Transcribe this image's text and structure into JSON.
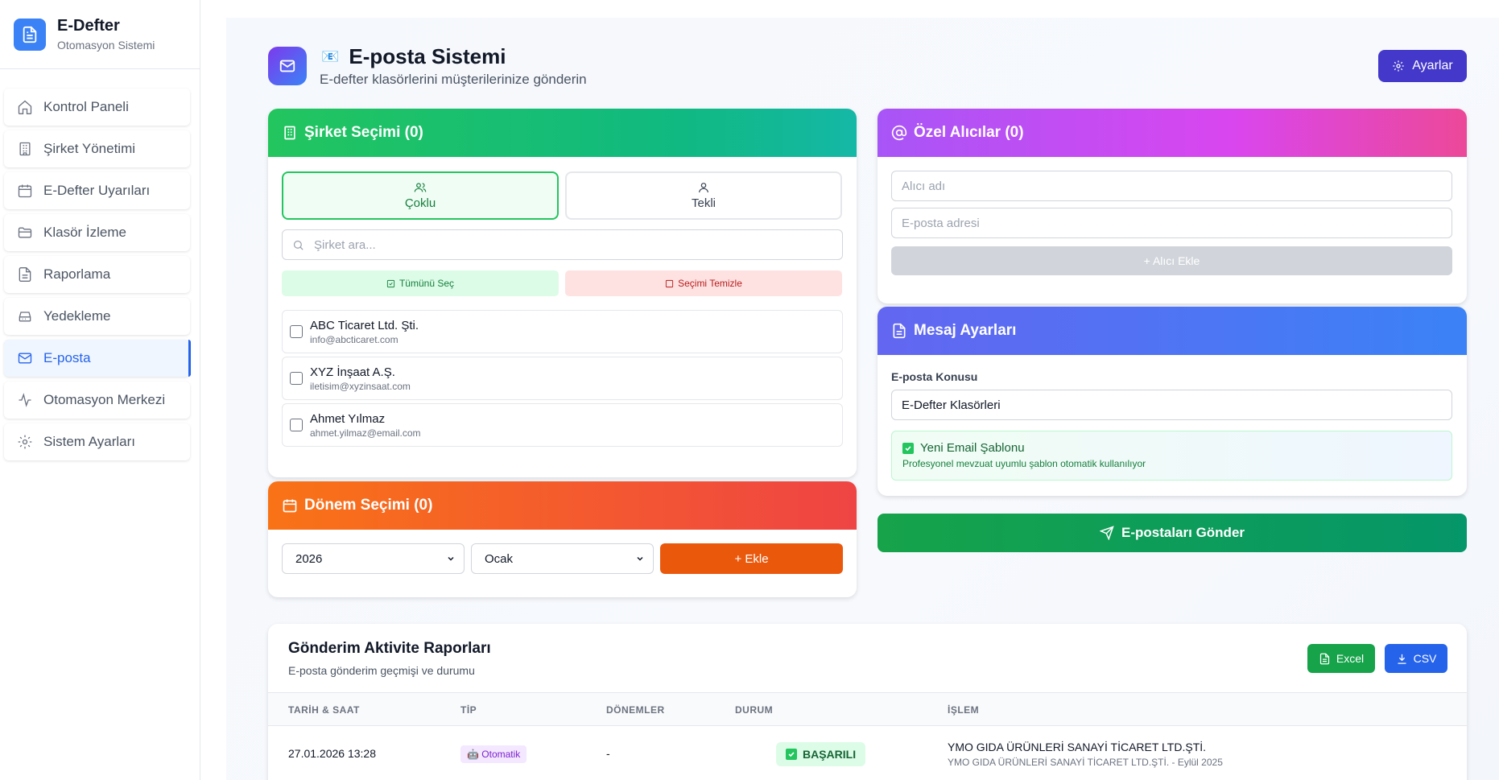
{
  "brand": {
    "title": "E-Defter",
    "subtitle": "Otomasyon Sistemi"
  },
  "sidebar": {
    "items": [
      {
        "label": "Kontrol Paneli",
        "icon": "home-icon"
      },
      {
        "label": "Şirket Yönetimi",
        "icon": "building-icon"
      },
      {
        "label": "E-Defter Uyarıları",
        "icon": "calendar-icon"
      },
      {
        "label": "Klasör İzleme",
        "icon": "folder-icon"
      },
      {
        "label": "Raporlama",
        "icon": "file-icon"
      },
      {
        "label": "Yedekleme",
        "icon": "drive-icon"
      },
      {
        "label": "E-posta",
        "icon": "mail-icon",
        "active": true
      },
      {
        "label": "Otomasyon Merkezi",
        "icon": "activity-icon"
      },
      {
        "label": "Sistem Ayarları",
        "icon": "gear-icon"
      }
    ]
  },
  "header": {
    "emoji": "📧",
    "title": "E-posta Sistemi",
    "subtitle": "E-defter klasörlerini müşterilerinize gönderin",
    "settings_label": "Ayarlar"
  },
  "company_card": {
    "title": "Şirket Seçimi (0)",
    "mode_multi": "Çoklu",
    "mode_single": "Tekli",
    "search_placeholder": "Şirket ara...",
    "select_all": "Tümünü Seç",
    "clear_selection": "Seçimi Temizle",
    "companies": [
      {
        "name": "ABC Ticaret Ltd. Şti.",
        "email": "info@abcticaret.com"
      },
      {
        "name": "XYZ İnşaat A.Ş.",
        "email": "iletisim@xyzinsaat.com"
      },
      {
        "name": "Ahmet Yılmaz",
        "email": "ahmet.yilmaz@email.com"
      }
    ]
  },
  "period_card": {
    "title": "Dönem Seçimi (0)",
    "year": "2026",
    "month": "Ocak",
    "add_label": "+ Ekle"
  },
  "recipients_card": {
    "title": "Özel Alıcılar (0)",
    "name_placeholder": "Alıcı adı",
    "email_placeholder": "E-posta adresi",
    "add_label": "+ Alıcı Ekle"
  },
  "message_card": {
    "title": "Mesaj Ayarları",
    "subject_label": "E-posta Konusu",
    "subject_value": "E-Defter Klasörleri",
    "template_title": "Yeni Email Şablonu",
    "template_desc": "Profesyonel mevzuat uyumlu şablon otomatik kullanılıyor"
  },
  "send_label": "E-postaları Gönder",
  "report": {
    "title": "Gönderim Aktivite Raporları",
    "subtitle": "E-posta gönderim geçmişi ve durumu",
    "excel_label": "Excel",
    "csv_label": "CSV",
    "columns": [
      "TARİH & SAAT",
      "TİP",
      "DÖNEMLER",
      "DURUM",
      "İŞLEM"
    ],
    "rows": [
      {
        "datetime": "27.01.2026 13:28",
        "type": "🤖 Otomatik",
        "periods": "-",
        "status": "BAŞARILI",
        "operation": "YMO GIDA ÜRÜNLERİ SANAYİ TİCARET LTD.ŞTİ.",
        "operation_detail": "YMO GIDA ÜRÜNLERİ SANAYİ TİCARET LTD.ŞTİ. - Eylül 2025"
      }
    ]
  },
  "colors": {
    "primary": "#2563eb",
    "success": "#16a34a",
    "orange": "#ea580c",
    "purple": "#a855f7",
    "indigo": "#4338ca"
  }
}
